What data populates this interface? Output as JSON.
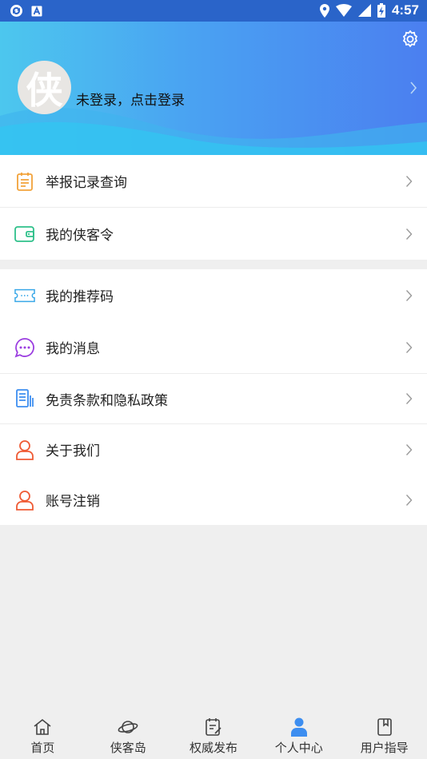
{
  "status_bar": {
    "time": "4:57"
  },
  "header": {
    "login_text": "未登录，点击登录",
    "avatar_char": "侠"
  },
  "colors": {
    "accent": "#3d8ef0",
    "header_start": "#4cc7ee",
    "header_end": "#4b7ff0",
    "status_bar": "#2a64c9"
  },
  "menu": {
    "group1": [
      {
        "label": "举报记录查询",
        "icon": "clipboard-icon"
      },
      {
        "label": "我的侠客令",
        "icon": "wallet-icon"
      }
    ],
    "group2": [
      {
        "label": "我的推荐码",
        "icon": "ticket-icon"
      },
      {
        "label": "我的消息",
        "icon": "message-icon"
      },
      {
        "label": "免责条款和隐私政策",
        "icon": "document-icon"
      },
      {
        "label": "关于我们",
        "icon": "person-icon"
      },
      {
        "label": "账号注销",
        "icon": "person-icon"
      }
    ]
  },
  "bottom_nav": [
    {
      "label": "首页",
      "icon": "home-icon"
    },
    {
      "label": "侠客岛",
      "icon": "planet-icon"
    },
    {
      "label": "权威发布",
      "icon": "edit-doc-icon"
    },
    {
      "label": "个人中心",
      "icon": "user-icon",
      "active": true
    },
    {
      "label": "用户指导",
      "icon": "book-icon"
    }
  ]
}
